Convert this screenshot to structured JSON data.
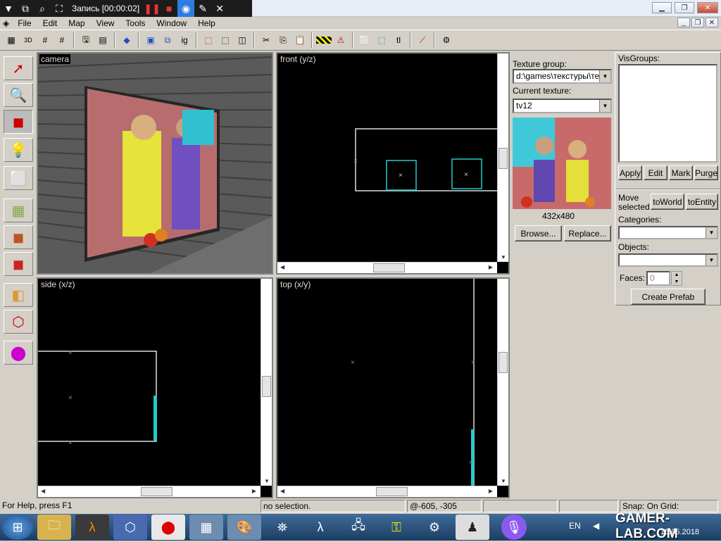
{
  "recorder": {
    "label": "Запись [00:00:02]"
  },
  "menu": [
    "File",
    "Edit",
    "Map",
    "View",
    "Tools",
    "Window",
    "Help"
  ],
  "toolbar": {
    "ig_label": "ig",
    "tl_label": "tl"
  },
  "viewports": {
    "camera": "camera",
    "front": "front (y/z)",
    "side": "side (x/z)",
    "top": "top (x/y)"
  },
  "texture": {
    "group_label": "Texture group:",
    "group_value": "d:\\games\\текстуры\\тек",
    "current_label": "Current texture:",
    "current_value": "tv12",
    "size": "432x480",
    "browse": "Browse...",
    "replace": "Replace..."
  },
  "visgroups": {
    "label": "VisGroups:",
    "apply": "Apply",
    "edit": "Edit",
    "mark": "Mark",
    "purge": "Purge"
  },
  "move": {
    "label": "Move selected:",
    "to_world": "toWorld",
    "to_entity": "toEntity"
  },
  "categories_label": "Categories:",
  "objects_label": "Objects:",
  "faces": {
    "label": "Faces:",
    "value": "0"
  },
  "create_prefab": "Create Prefab",
  "status": {
    "help": "For Help, press F1",
    "selection": "no selection.",
    "coords": "@-605, -305",
    "snap": "Snap: On Grid:"
  },
  "taskbar": {
    "lang": "EN",
    "watermark": "GAMER-LAB.COM",
    "date": "15.05.2018"
  }
}
